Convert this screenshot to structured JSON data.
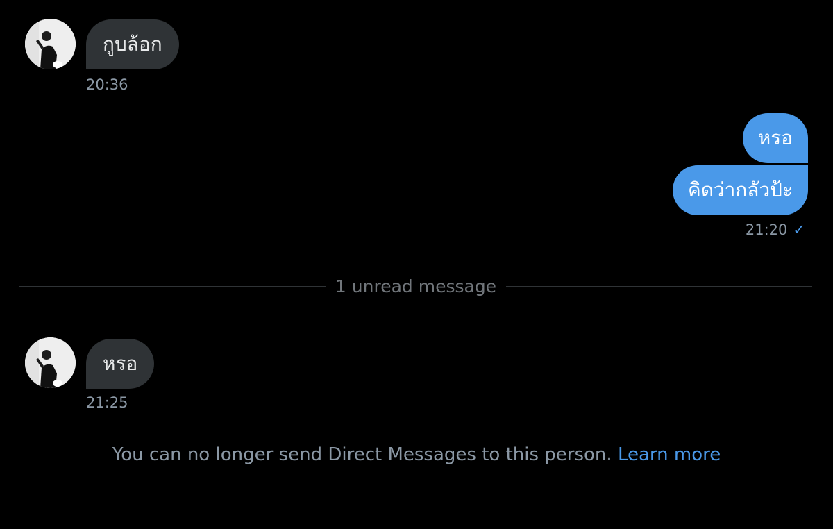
{
  "conversation": {
    "messages": [
      {
        "direction": "incoming",
        "text": "กูบล้อก",
        "time": "20:36"
      },
      {
        "direction": "outgoing",
        "text": "หรอ"
      },
      {
        "direction": "outgoing",
        "text": "คิดว่ากลัวป้ะ",
        "time": "21:20",
        "status_icon": "✓"
      },
      {
        "direction": "incoming",
        "text": "หรอ",
        "time": "21:25"
      }
    ],
    "unread_divider": "1 unread message"
  },
  "footer": {
    "notice_text": "You can no longer send Direct Messages to this person.",
    "learn_more_label": "Learn more"
  },
  "colors": {
    "background": "#000000",
    "incoming_bubble": "#2f3336",
    "outgoing_bubble": "#4a99e9",
    "accent": "#4a99e9",
    "muted_text": "#8b98a5"
  }
}
